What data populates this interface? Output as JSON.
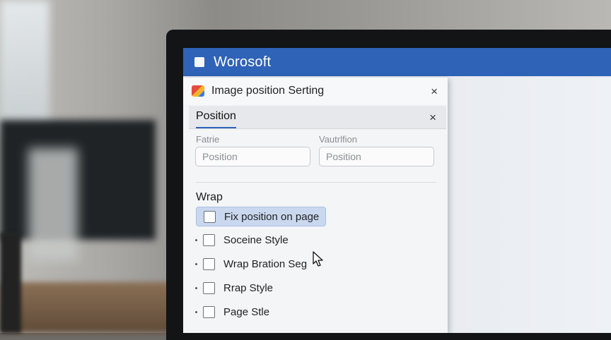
{
  "app": {
    "title": "Worosoft"
  },
  "dialog": {
    "title": "Image position Serting",
    "close_symbol": "×",
    "tab": "Position",
    "fields": [
      {
        "label": "Fatrie",
        "value": "Position"
      },
      {
        "label": "Vautrlfion",
        "value": "Position"
      }
    ],
    "section_title": "Wrap",
    "options": [
      {
        "label": "Fix position on page",
        "checked": false,
        "highlighted": true
      },
      {
        "label": "Soceine Style",
        "checked": false,
        "highlighted": false
      },
      {
        "label": "Wrap Bration Seg",
        "checked": false,
        "highlighted": false
      },
      {
        "label": "Rrap Style",
        "checked": false,
        "highlighted": false
      },
      {
        "label": "Page Stle",
        "checked": false,
        "highlighted": false
      }
    ]
  },
  "colors": {
    "titlebar": "#2f63b8",
    "highlight": "#c9d8ef"
  },
  "icons": [
    "app-icon",
    "dialog-app-icon",
    "close-icon",
    "checkbox-icon",
    "mouse-cursor-icon"
  ]
}
